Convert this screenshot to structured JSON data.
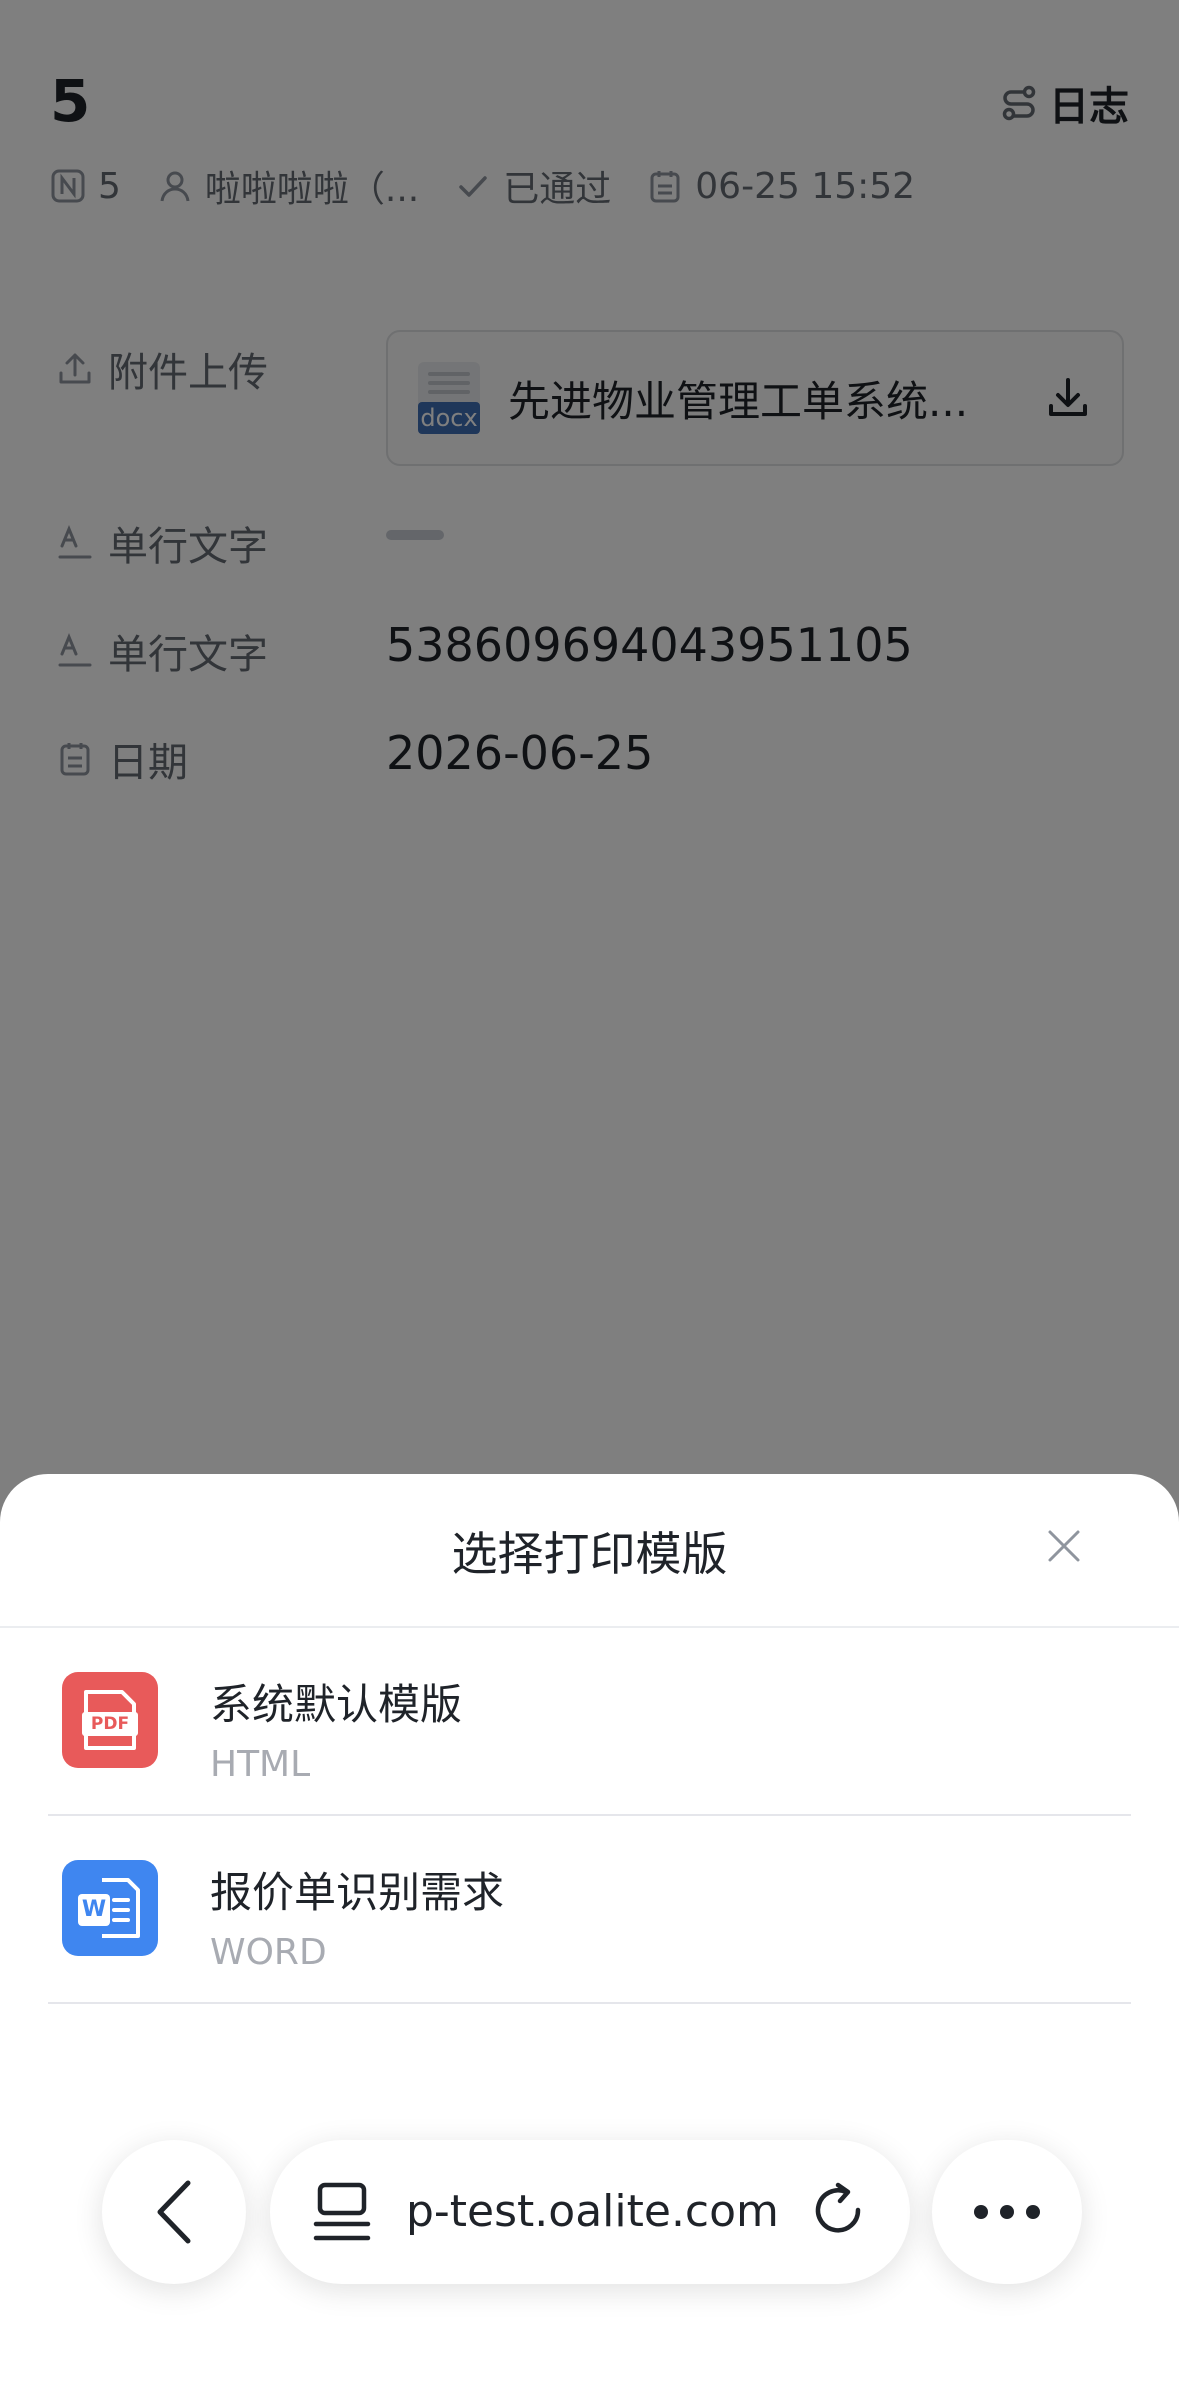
{
  "header": {
    "record_number": "5",
    "log_label": "日志"
  },
  "meta": {
    "number": "5",
    "creator": "啦啦啦啦（...",
    "status": "已通过",
    "datetime": "06-25 15:52"
  },
  "fields": {
    "attachment": {
      "label": "附件上传",
      "file_badge": "docx",
      "file_name": "先进物业管理工单系统..."
    },
    "text1": {
      "label": "单行文字"
    },
    "text2": {
      "label": "单行文字",
      "value": "538609694043951105"
    },
    "date": {
      "label": "日期",
      "value": "2026-06-25"
    }
  },
  "sheet": {
    "title": "选择打印模版",
    "templates": [
      {
        "name": "系统默认模版",
        "type": "HTML",
        "icon": "pdf-icon",
        "icon_text": "PDF",
        "color": "#e85a5a"
      },
      {
        "name": "报价单识别需求",
        "type": "WORD",
        "icon": "word-icon",
        "icon_text": "W",
        "color": "#3f86f0"
      }
    ]
  },
  "browser": {
    "url": "p-test.oalite.com"
  }
}
